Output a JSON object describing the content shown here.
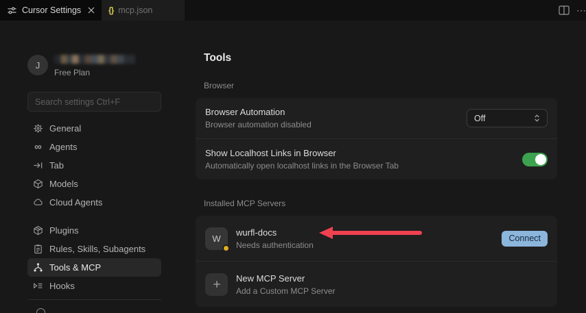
{
  "tab_bar": {
    "tabs": [
      {
        "label": "Cursor Settings",
        "icon": "settings-sliders-icon",
        "active": true,
        "closable": true
      },
      {
        "label": "mcp.json",
        "icon": "braces-icon",
        "icon_glyph": "{}",
        "active": false
      }
    ],
    "actions": {
      "split_editor_icon": "split-editor-icon",
      "more_glyph": "⋯"
    }
  },
  "sidebar": {
    "user": {
      "initial": "J",
      "name_redacted": true,
      "plan": "Free Plan"
    },
    "search": {
      "placeholder": "Search settings Ctrl+F"
    },
    "groups": [
      {
        "items": [
          {
            "label": "General",
            "icon": "gear-icon"
          },
          {
            "label": "Agents",
            "icon": "infinity-icon",
            "icon_glyph": "∞"
          },
          {
            "label": "Tab",
            "icon": "tab-arrow-icon"
          },
          {
            "label": "Models",
            "icon": "cube-icon"
          },
          {
            "label": "Cloud Agents",
            "icon": "cloud-icon"
          }
        ]
      },
      {
        "items": [
          {
            "label": "Plugins",
            "icon": "package-icon"
          },
          {
            "label": "Rules, Skills, Subagents",
            "icon": "clipboard-icon"
          },
          {
            "label": "Tools & MCP",
            "icon": "fork-icon",
            "selected": true
          },
          {
            "label": "Hooks",
            "icon": "hooks-list-icon"
          }
        ]
      }
    ]
  },
  "main": {
    "title": "Tools",
    "browser_section": {
      "label": "Browser",
      "rows": [
        {
          "title": "Browser Automation",
          "subtitle": "Browser automation disabled",
          "control": {
            "type": "select",
            "value": "Off"
          }
        },
        {
          "title": "Show Localhost Links in Browser",
          "subtitle": "Automatically open localhost links in the Browser Tab",
          "control": {
            "type": "toggle",
            "state": "on",
            "color": "#3da24f"
          }
        }
      ]
    },
    "mcp_section": {
      "label": "Installed MCP Servers",
      "servers": [
        {
          "avatar_initial": "W",
          "name": "wurfl-docs",
          "status": "Needs authentication",
          "status_dot_color": "#dfaf1e",
          "action_label": "Connect",
          "action_color": "#8cb5dc"
        }
      ],
      "new_server": {
        "title": "New MCP Server",
        "subtitle": "Add a Custom MCP Server",
        "icon": "plus-icon"
      }
    }
  },
  "annotation": {
    "type": "arrow",
    "direction": "left",
    "color": "#ef4150",
    "points_at": "wurfl-docs"
  }
}
